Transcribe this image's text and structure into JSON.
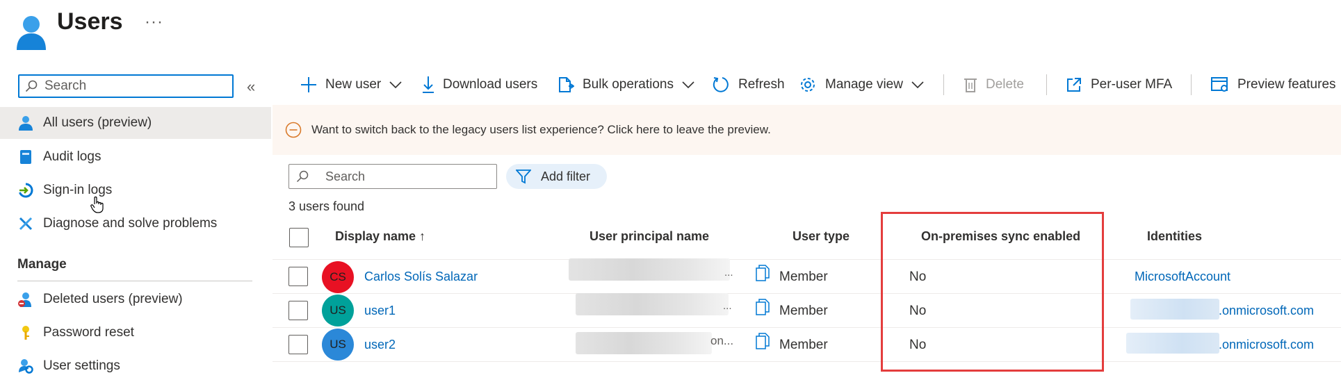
{
  "header": {
    "title": "Users",
    "more": "···"
  },
  "nav": {
    "search_placeholder": "Search",
    "collapse": "«",
    "items": [
      {
        "label": "All users (preview)",
        "icon": "user-icon",
        "active": true
      },
      {
        "label": "Audit logs",
        "icon": "audit-log-icon"
      },
      {
        "label": "Sign-in logs",
        "icon": "sign-in-icon"
      },
      {
        "label": "Diagnose and solve problems",
        "icon": "wrench-icon"
      }
    ],
    "manage_header": "Manage",
    "manage_items": [
      {
        "label": "Deleted users (preview)",
        "icon": "deleted-user-icon"
      },
      {
        "label": "Password reset",
        "icon": "key-icon"
      },
      {
        "label": "User settings",
        "icon": "user-settings-icon"
      }
    ]
  },
  "toolbar": {
    "new_user": "New user",
    "download_users": "Download users",
    "bulk_operations": "Bulk operations",
    "refresh": "Refresh",
    "manage_view": "Manage view",
    "delete": "Delete",
    "per_user_mfa": "Per-user MFA",
    "preview_features": "Preview features"
  },
  "banner": {
    "text": "Want to switch back to the legacy users list experience? Click here to leave the preview."
  },
  "content": {
    "search_placeholder": "Search",
    "add_filter": "Add filter",
    "users_found": "3 users found"
  },
  "table": {
    "columns": {
      "display_name": "Display name ↑",
      "upn": "User principal name",
      "user_type": "User type",
      "sync": "On-premises sync enabled",
      "identities": "Identities"
    },
    "rows": [
      {
        "initials": "CS",
        "avatar_color": "#e81123",
        "name": "Carlos Solís Salazar",
        "upn_tail": "...",
        "user_type": "Member",
        "sync": "No",
        "identity": "MicrosoftAccount"
      },
      {
        "initials": "US",
        "avatar_color": "#00a19a",
        "name": "user1",
        "upn_tail": "...",
        "user_type": "Member",
        "sync": "No",
        "identity": ".onmicrosoft.com"
      },
      {
        "initials": "US",
        "avatar_color": "#2b88d8",
        "name": "user2",
        "upn_tail": "on...",
        "user_type": "Member",
        "sync": "No",
        "identity": ".onmicrosoft.com"
      }
    ]
  },
  "colors": {
    "accent": "#0078d4",
    "link": "#0067b8",
    "banner_bg": "#fdf6f1",
    "highlight": "#e43d3d"
  }
}
